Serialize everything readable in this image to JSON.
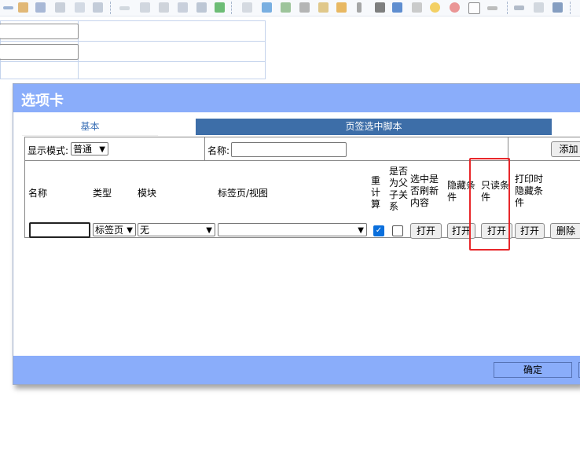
{
  "toolbar": {
    "icons": [
      "minus-icon",
      "copy-icon",
      "page-icon",
      "code-icon",
      "preview-icon",
      "list-icon",
      "pencil-icon",
      "cube-icon",
      "image-icon",
      "camera-icon",
      "document-icon",
      "map-icon",
      "stamp-icon",
      "qrcode-icon",
      "word-icon",
      "chart-icon",
      "circle-icon",
      "settings-icon",
      "number-icon",
      "line-icon",
      "link-icon",
      "gear-icon",
      "anchor-icon"
    ]
  },
  "dialog": {
    "title": "选项卡",
    "tabs": {
      "basic": "基本",
      "script": "页签选中脚本"
    },
    "display_mode_label": "显示模式:",
    "display_mode_value": "普通",
    "name_label": "名称:",
    "add_button": "添加",
    "columns": {
      "name": "名称",
      "type": "类型",
      "module": "模块",
      "tabview": "标签页/视图",
      "recalc": [
        "重",
        "计",
        "算"
      ],
      "parent_child": [
        "是否",
        "为父",
        "子关",
        "系"
      ],
      "refresh": [
        "选中是",
        "否刷新",
        "内容"
      ],
      "hide_cond": [
        "隐藏条",
        "件"
      ],
      "readonly_cond": [
        "只读条",
        "件"
      ],
      "print_hide": [
        "打印时",
        "隐藏条",
        "件"
      ]
    },
    "row": {
      "name": "",
      "type": "标签页",
      "module": "无",
      "tabview": "",
      "recalc_checked": true,
      "parent_child_checked": false,
      "refresh_button": "打开",
      "hide_button": "打开",
      "readonly_button": "打开",
      "print_hide_button": "打开",
      "delete_button": "删除"
    },
    "ok_button": "确定"
  }
}
